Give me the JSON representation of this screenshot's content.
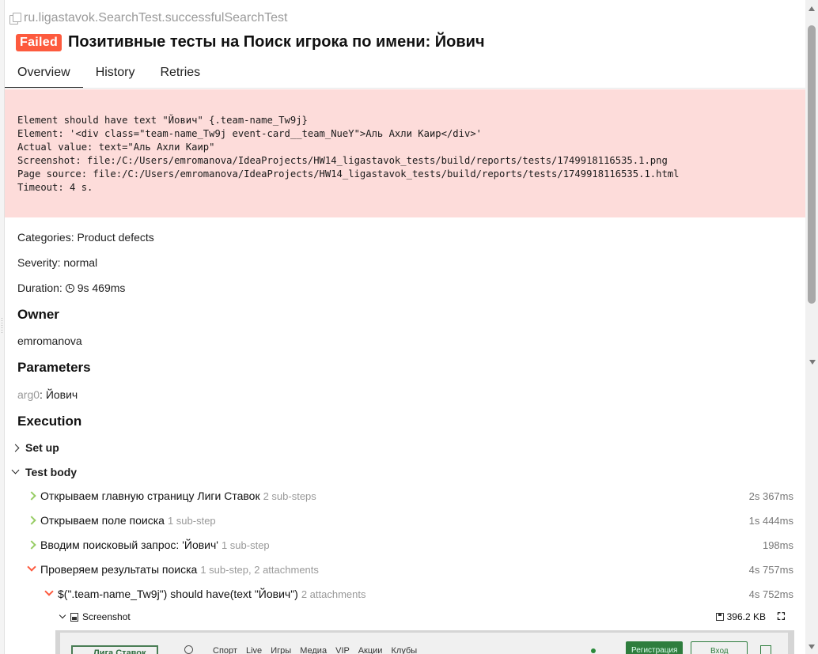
{
  "header": {
    "full_name": "ru.ligastavok.SearchTest.successfulSearchTest",
    "status": "Failed",
    "title": "Позитивные тесты на Поиск игрока по имени: Йович"
  },
  "tabs": [
    {
      "label": "Overview",
      "active": true
    },
    {
      "label": "History",
      "active": false
    },
    {
      "label": "Retries",
      "active": false
    }
  ],
  "error": {
    "message": "Element should have text \"Йович\" {.team-name_Tw9j}\nElement: '<div class=\"team-name_Tw9j event-card__team_NueY\">Аль Ахли Каир</div>'\nActual value: text=\"Аль Ахли Каир\"\nScreenshot: file:/C:/Users/emromanova/IdeaProjects/HW14_ligastavok_tests/build/reports/tests/1749918116535.1.png\nPage source: file:/C:/Users/emromanova/IdeaProjects/HW14_ligastavok_tests/build/reports/tests/1749918116535.1.html\nTimeout: 4 s."
  },
  "meta": {
    "categories_label": "Categories:",
    "categories_value": "Product defects",
    "severity_label": "Severity:",
    "severity_value": "normal",
    "duration_label": "Duration:",
    "duration_value": "9s 469ms"
  },
  "owner": {
    "heading": "Owner",
    "value": "emromanova"
  },
  "parameters": {
    "heading": "Parameters",
    "name": "arg0",
    "value": "Йович"
  },
  "execution": {
    "heading": "Execution",
    "setup_label": "Set up",
    "body_label": "Test body",
    "steps": [
      {
        "label": "Открываем главную страницу Лиги Ставок",
        "sub": "2 sub-steps",
        "duration": "2s 367ms",
        "status": "passed"
      },
      {
        "label": "Открываем поле поиска",
        "sub": "1 sub-step",
        "duration": "1s 444ms",
        "status": "passed"
      },
      {
        "label": "Вводим поисковый запрос: 'Йович'",
        "sub": "1 sub-step",
        "duration": "198ms",
        "status": "passed"
      },
      {
        "label": "Проверяем результаты поиска",
        "sub": "1 sub-step, 2 attachments",
        "duration": "4s 757ms",
        "status": "failed"
      }
    ],
    "substep": {
      "label": "$(\".team-name_Tw9j\") should have(text \"Йович\")",
      "sub": "2 attachments",
      "duration": "4s 752ms",
      "status": "failed"
    },
    "attachment": {
      "label": "Screenshot",
      "size": "396.2 KB"
    }
  },
  "preview": {
    "logo": "Лига Ставок",
    "nav": "Спорт Live Игры Медиа VIP Акции Клубы",
    "register": "Регистрация",
    "login": "Вход"
  },
  "colors": {
    "failed": "#fd5a3e",
    "passed": "#97cc64",
    "error_bg": "#fddcda"
  }
}
